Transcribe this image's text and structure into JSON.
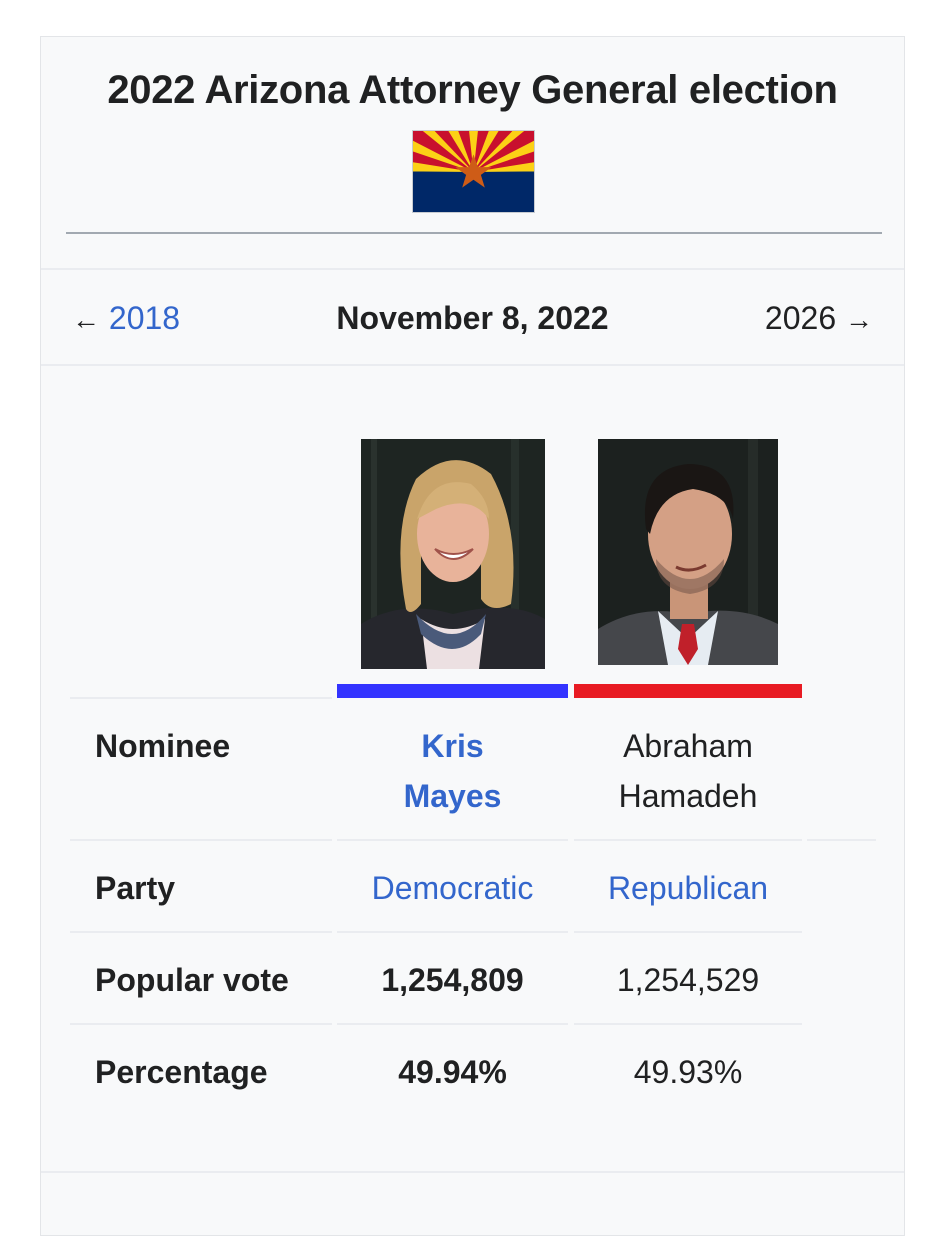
{
  "infobox": {
    "title": "2022 Arizona Attorney General election",
    "flag": {
      "icon": "arizona-flag-icon",
      "colors": {
        "red": "#c8102e",
        "yellow": "#fcd116",
        "blue": "#002868",
        "star": "#ce5c17"
      }
    },
    "navigation": {
      "prev_arrow": "←",
      "prev_year": "2018",
      "date": "November 8, 2022",
      "next_year": "2026",
      "next_arrow": "→"
    },
    "candidates": [
      {
        "photo_alt": "Kris Mayes portrait",
        "party_color": "#3333ff",
        "nominee": [
          "Kris",
          "Mayes"
        ],
        "party": "Democratic",
        "popular_vote": "1,254,809",
        "percentage": "49.94%",
        "winner": true
      },
      {
        "photo_alt": "Abraham Hamadeh portrait",
        "party_color": "#e81b23",
        "nominee": [
          "Abraham",
          "Hamadeh"
        ],
        "party": "Republican",
        "popular_vote": "1,254,529",
        "percentage": "49.93%",
        "winner": false
      }
    ],
    "row_labels": {
      "nominee": "Nominee",
      "party": "Party",
      "popular_vote": "Popular vote",
      "percentage": "Percentage"
    },
    "colors": {
      "link": "#3366cc",
      "text": "#202122",
      "background": "#f8f9fa"
    }
  }
}
